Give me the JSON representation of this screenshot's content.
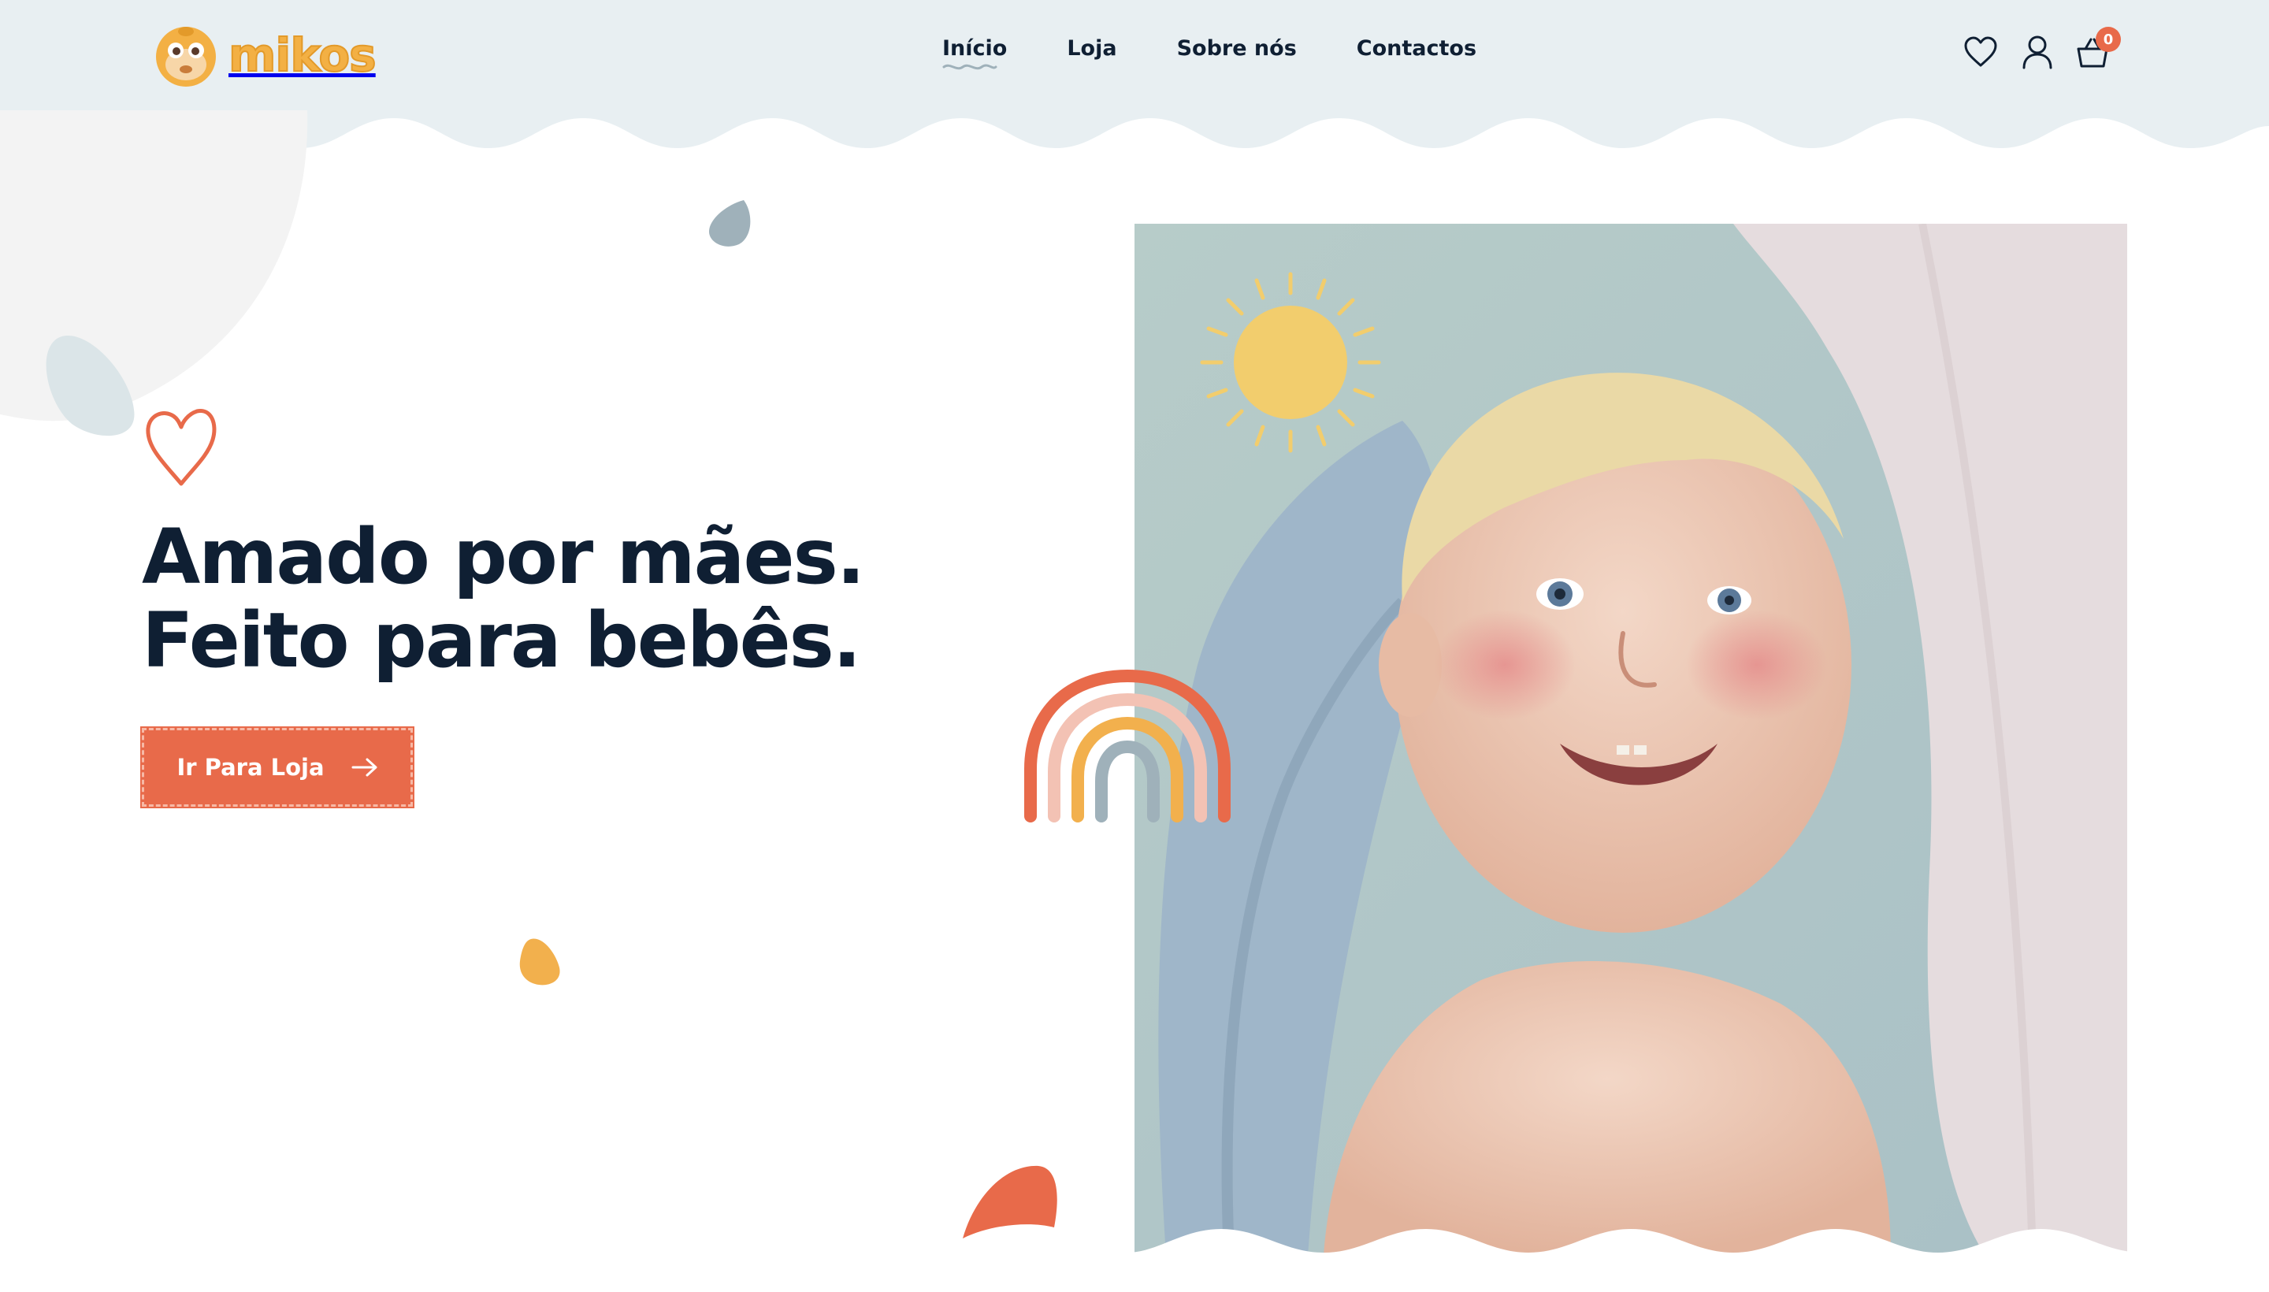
{
  "brand": {
    "name": "mikos",
    "primary_color": "#e86a4a",
    "logo_color": "#f3b044",
    "header_bg": "#e8eff2",
    "text_color": "#0f1f33"
  },
  "nav": {
    "items": [
      {
        "label": "Início",
        "active": true
      },
      {
        "label": "Loja",
        "active": false
      },
      {
        "label": "Sobre nós",
        "active": false
      },
      {
        "label": "Contactos",
        "active": false
      }
    ]
  },
  "header_icons": {
    "wishlist": "heart-icon",
    "account": "user-icon",
    "cart": "basket-icon",
    "cart_count": "0"
  },
  "hero": {
    "title_line1": "Amado por mães.",
    "title_line2": "Feito para bebês.",
    "cta_label": "Ir Para Loja",
    "cta_icon": "arrow-right-icon"
  }
}
